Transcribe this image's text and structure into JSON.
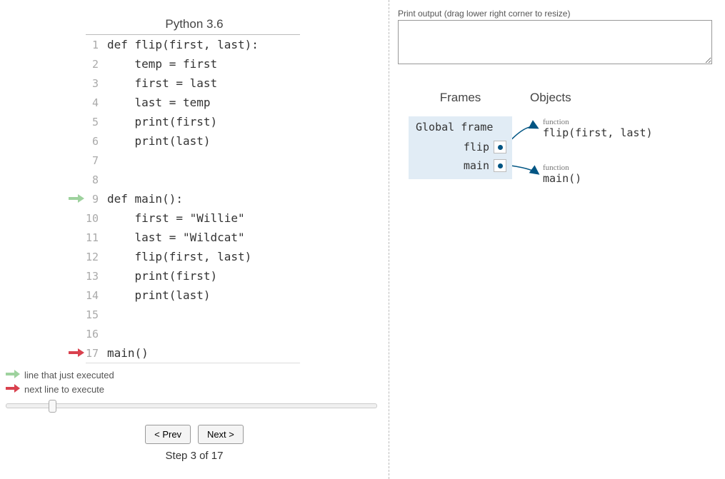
{
  "language": "Python 3.6",
  "code_lines": [
    {
      "n": 1,
      "text": "def flip(first, last):"
    },
    {
      "n": 2,
      "text": "    temp = first"
    },
    {
      "n": 3,
      "text": "    first = last"
    },
    {
      "n": 4,
      "text": "    last = temp"
    },
    {
      "n": 5,
      "text": "    print(first)"
    },
    {
      "n": 6,
      "text": "    print(last)"
    },
    {
      "n": 7,
      "text": ""
    },
    {
      "n": 8,
      "text": ""
    },
    {
      "n": 9,
      "text": "def main():"
    },
    {
      "n": 10,
      "text": "    first = \"Willie\""
    },
    {
      "n": 11,
      "text": "    last = \"Wildcat\""
    },
    {
      "n": 12,
      "text": "    flip(first, last)"
    },
    {
      "n": 13,
      "text": "    print(first)"
    },
    {
      "n": 14,
      "text": "    print(last)"
    },
    {
      "n": 15,
      "text": ""
    },
    {
      "n": 16,
      "text": ""
    },
    {
      "n": 17,
      "text": "main()"
    }
  ],
  "arrows": {
    "just_executed_line": 9,
    "next_line": 17
  },
  "legend": {
    "just_executed": "line that just executed",
    "next": "next line to execute"
  },
  "controls": {
    "prev": "< Prev",
    "next": "Next >",
    "step": "Step 3 of 17",
    "current_step": 3,
    "total_steps": 17
  },
  "output": {
    "label": "Print output (drag lower right corner to resize)",
    "value": ""
  },
  "viz": {
    "frames_header": "Frames",
    "objects_header": "Objects",
    "global_frame_title": "Global frame",
    "vars": [
      {
        "name": "flip"
      },
      {
        "name": "main"
      }
    ],
    "objects": [
      {
        "type": "function",
        "sig": "flip(first, last)"
      },
      {
        "type": "function",
        "sig": "main()"
      }
    ]
  }
}
